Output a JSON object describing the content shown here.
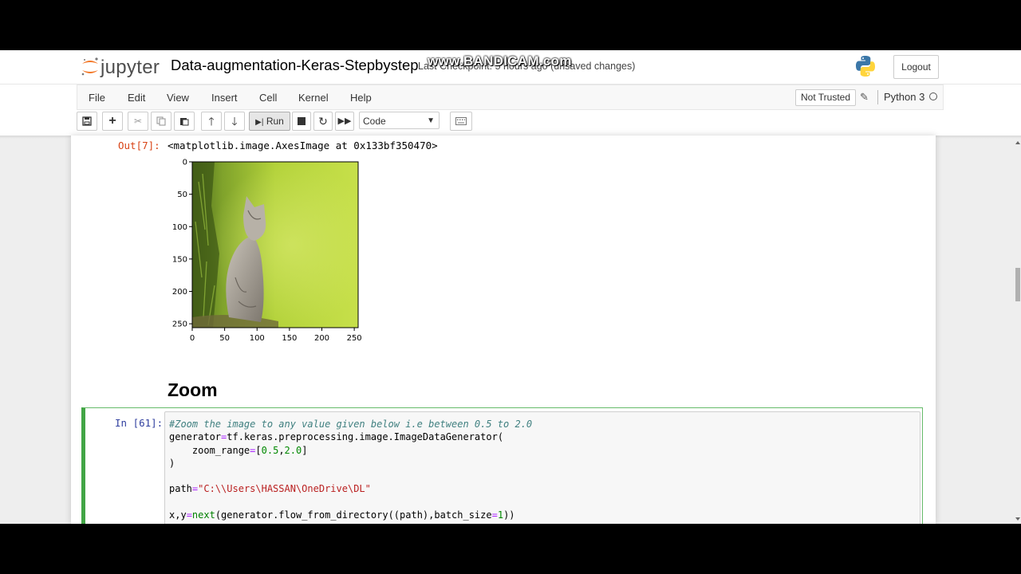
{
  "header": {
    "logo_text": "jupyter",
    "notebook_name": "Data-augmentation-Keras-Stepbystep",
    "checkpoint": "Last Checkpoint: 5 hours ago  (unsaved changes)",
    "watermark": "www.BANDICAM.com",
    "logout_label": "Logout"
  },
  "menu": {
    "items": [
      "File",
      "Edit",
      "View",
      "Insert",
      "Cell",
      "Kernel",
      "Help"
    ],
    "not_trusted": "Not Trusted",
    "kernel_name": "Python 3"
  },
  "toolbar": {
    "run_label": "Run",
    "cell_type": "Code",
    "icons": [
      "save-icon",
      "plus-icon",
      "scissors-icon",
      "copy-icon",
      "paste-icon",
      "arrow-up-icon",
      "arrow-down-icon",
      "run-icon",
      "stop-icon",
      "restart-icon",
      "fast-forward-icon",
      "keyboard-icon"
    ]
  },
  "output": {
    "prompt": "Out[7]:",
    "repr": "<matplotlib.image.AxesImage at 0x133bf350470>"
  },
  "plot": {
    "image_description": "kitten sitting in green grass",
    "x_ticks": [
      "0",
      "50",
      "100",
      "150",
      "200",
      "250"
    ],
    "y_ticks": [
      "0",
      "50",
      "100",
      "150",
      "200",
      "250"
    ]
  },
  "markdown": {
    "heading": "Zoom"
  },
  "code_cell": {
    "prompt": "In [61]:",
    "lines": [
      "#Zoom the image to any value given below i.e between 0.5 to 2.0",
      "generator=tf.keras.preprocessing.image.ImageDataGenerator(",
      "    zoom_range=[0.5,2.0]",
      ")",
      "",
      "path=\"C:\\\\Users\\HASSAN\\OneDrive\\DL\"",
      "",
      "x,y=next(generator.flow_from_directory((path),batch_size=1))"
    ]
  }
}
